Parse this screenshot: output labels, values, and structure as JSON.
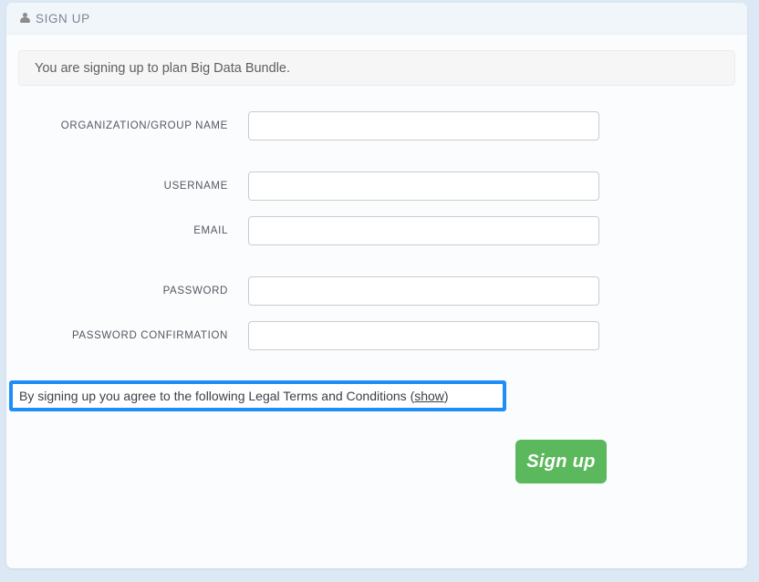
{
  "header": {
    "icon": "user-icon",
    "title": "SIGN UP"
  },
  "alert": {
    "message": "You are signing up to plan Big Data Bundle."
  },
  "form": {
    "fields": [
      {
        "label": "ORGANIZATION/GROUP NAME",
        "value": "",
        "placeholder": "",
        "type": "text"
      },
      {
        "label": "USERNAME",
        "value": "",
        "placeholder": "",
        "type": "text"
      },
      {
        "label": "EMAIL",
        "value": "",
        "placeholder": "",
        "type": "text"
      },
      {
        "label": "PASSWORD",
        "value": "",
        "placeholder": "",
        "type": "password"
      },
      {
        "label": "PASSWORD CONFIRMATION",
        "value": "",
        "placeholder": "",
        "type": "password"
      }
    ]
  },
  "terms": {
    "text_before": "By signing up you agree to the following Legal Terms and Conditions (",
    "link_label": "show",
    "text_after": ")"
  },
  "submit": {
    "label": "Sign up"
  },
  "colors": {
    "page_background": "#dce9f4",
    "panel_background": "#fbfcfe",
    "header_background": "#f1f6fb",
    "alert_background": "#f6f6f6",
    "highlight_border": "#1f8ff7",
    "submit_green": "#5cb85c",
    "label_text": "#51585f"
  }
}
